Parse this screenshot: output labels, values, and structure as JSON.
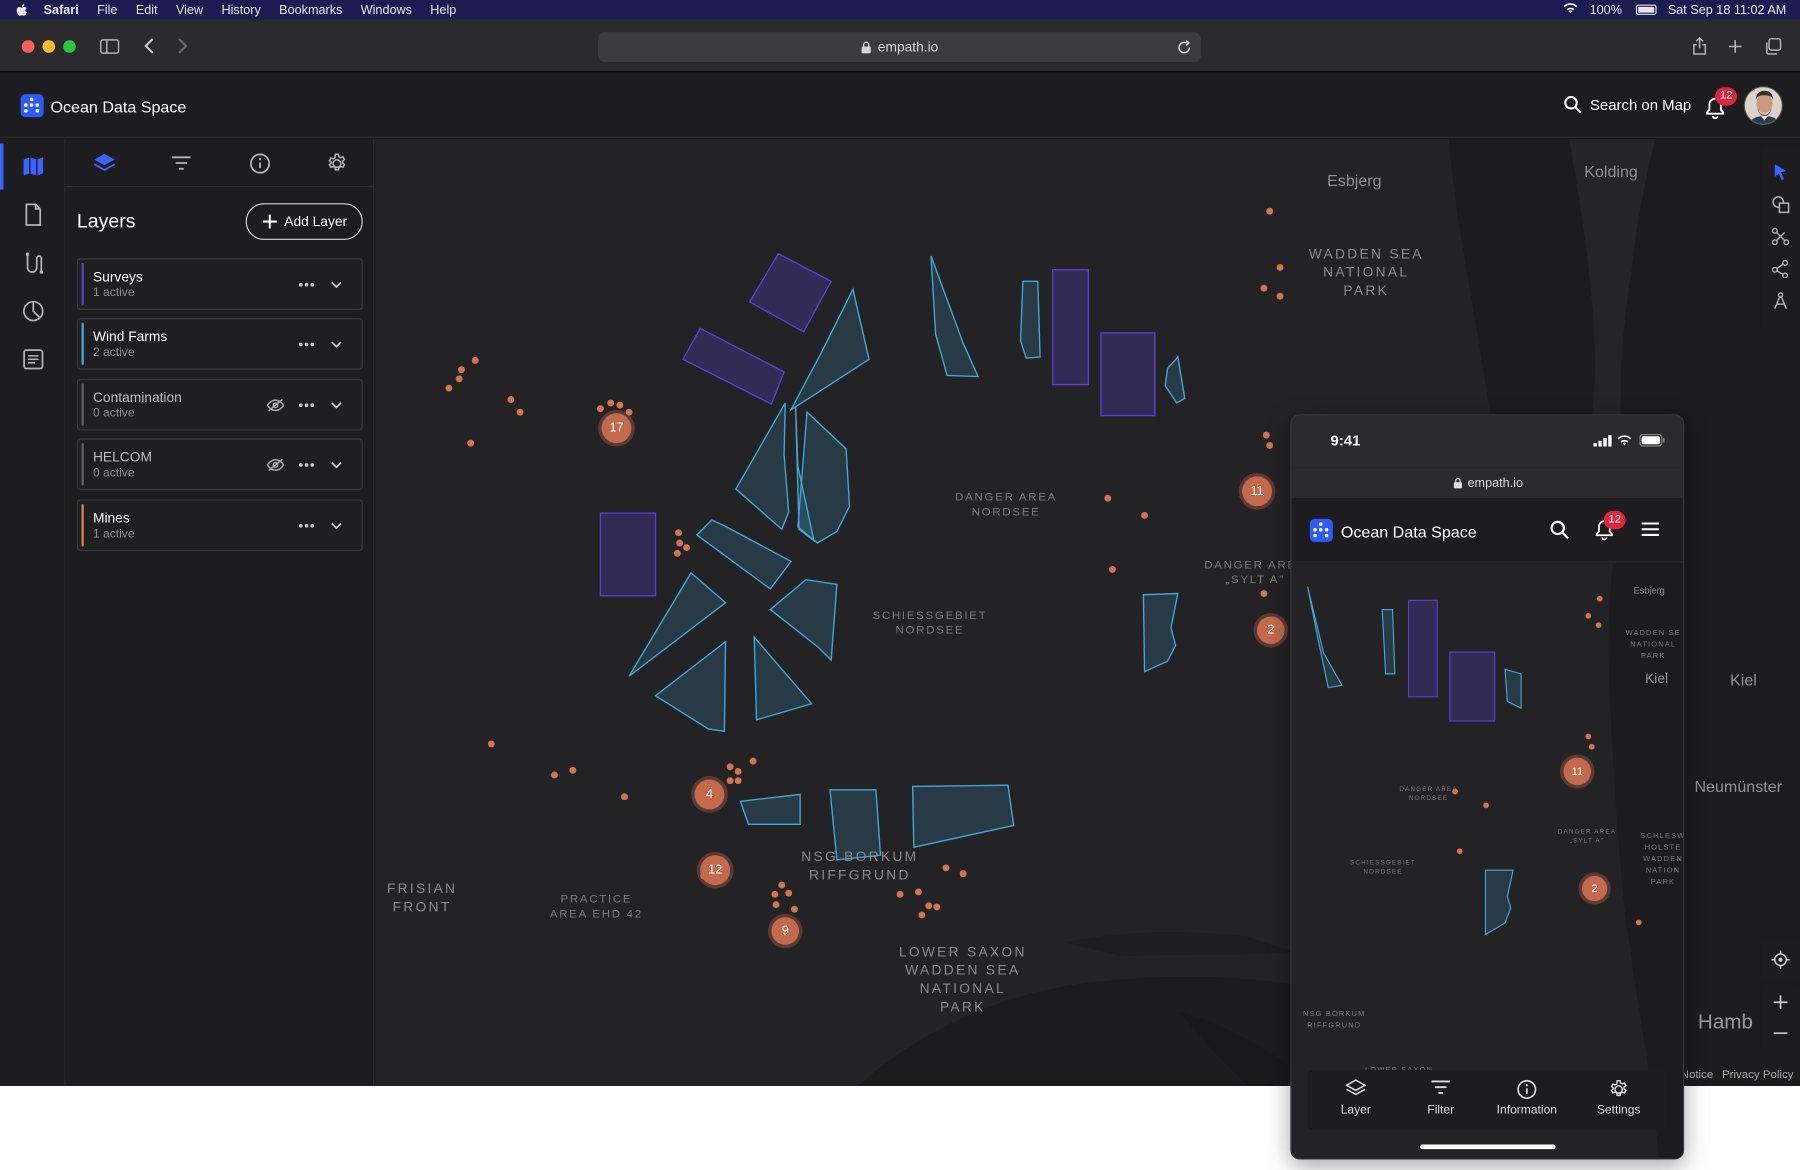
{
  "menubar": {
    "items": [
      "Safari",
      "File",
      "Edit",
      "View",
      "History",
      "Bookmarks",
      "Windows",
      "Help"
    ],
    "battery": "100%",
    "datetime": "Sat Sep 18  11:02 AM"
  },
  "browser": {
    "url": "empath.io"
  },
  "app": {
    "title": "Ocean Data Space",
    "search_label": "Search on Map",
    "notifications_count": "12",
    "accent": "#3a63ff"
  },
  "panel": {
    "title": "Layers",
    "add_layer_label": "Add Layer",
    "layers": [
      {
        "name": "Surveys",
        "status": "1 active",
        "color": "#5a3fd1",
        "hidden": false
      },
      {
        "name": "Wind Farms",
        "status": "2 active",
        "color": "#3fa9d6",
        "hidden": false
      },
      {
        "name": "Contamination",
        "status": "0 active",
        "color": "#5f5f65",
        "hidden": true
      },
      {
        "name": "HELCOM",
        "status": "0 active",
        "color": "#5f5f65",
        "hidden": true
      },
      {
        "name": "Mines",
        "status": "1 active",
        "color": "#e07a4f",
        "hidden": false
      }
    ]
  },
  "map": {
    "cities": [
      "Esbjerg",
      "Kolding",
      "Kiel",
      "Neumünster",
      "Hamb"
    ],
    "areas": [
      "WADDEN SEA\nNATIONAL\nPARK",
      "DANGER AREA\nNORDSEE",
      "DANGER AREA\n„SYLT A\"",
      "SCHIESSGEBIET\nNORDSEE",
      "NSG BORKUM\nRIFFGRUND",
      "FRISIAN\nFRONT",
      "PRACTICE\nAREA EHD 42",
      "LOWER SAXON\nWADDEN SEA\nNATIONAL\nPARK"
    ],
    "clusters": [
      "17",
      "11",
      "2",
      "4",
      "12",
      "9"
    ],
    "attribution": [
      "Notice",
      "Privacy Policy"
    ],
    "mine_color": "#d4734f",
    "survey_color": "#5a3fd1",
    "windfarm_color": "#3fa9d6"
  },
  "phone": {
    "time": "9:41",
    "url": "empath.io",
    "title": "Ocean Data Space",
    "notifications_count": "12",
    "cities": [
      "Esbjerg",
      "Kiel"
    ],
    "areas": [
      "WADDEN SE\nNATIONAL\nPARK",
      "DANGER AREA\nNORDSEE",
      "DANGER AREA\n„SYLT A\"",
      "SCHIESSGEBIET\nNORDSEE",
      "SCHLESW\nHOLSTE\nWADDEN\nNATION\nPARK",
      "NSG BORKUM\nRIFFGRUND",
      "LOWER SAXON"
    ],
    "clusters": [
      "11",
      "2"
    ],
    "tabs": [
      "Layer",
      "Filter",
      "Information",
      "Settings"
    ]
  }
}
